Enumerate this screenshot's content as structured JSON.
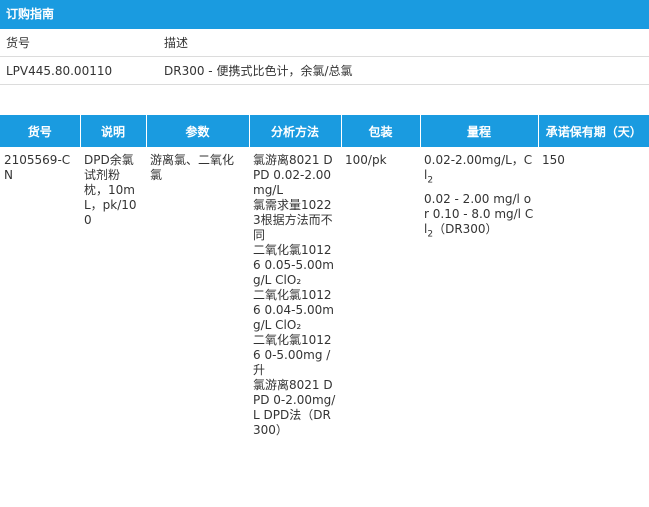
{
  "order_guide": {
    "title": "订购指南",
    "headers": {
      "catalog_no": "货号",
      "description": "描述"
    },
    "row": {
      "catalog_no": "LPV445.80.00110",
      "description": "DR300 - 便携式比色计，余氯/总氯"
    }
  },
  "product_table": {
    "columns": [
      "货号",
      "说明",
      "参数",
      "分析方法",
      "包装",
      "量程",
      "承诺保有期（天）"
    ],
    "row": {
      "catalog_no": "2105569-CN",
      "description": "DPD余氯试剂粉枕，10mL，pk/100",
      "parameter": "游离氯、二氧化氯",
      "method_lines": [
        "氯游离8021 DPD 0.02-2.00mg/L",
        "氯需求量10223根据方法而不同",
        "二氧化氯10126 0.05-5.00mg/L ClO₂",
        "二氧化氯10126 0.04-5.00mg/L ClO₂",
        "二氧化氯10126 0-5.00mg /升",
        "氯游离8021 DPD 0-2.00mg/L DPD法（DR300）"
      ],
      "packaging": "100/pk",
      "range_1": "0.02-2.00mg/L，Cl",
      "range_1_sub": "2",
      "range_2": "0.02 - 2.00 mg/l or 0.10 - 8.0 mg/l Cl",
      "range_2_sub": "2",
      "range_2_suffix": "（DR300）",
      "shelf_life": "150"
    }
  },
  "colors": {
    "header_bg": "#1a9be0",
    "header_text": "#ffffff",
    "row_border": "#dcdcdc"
  }
}
